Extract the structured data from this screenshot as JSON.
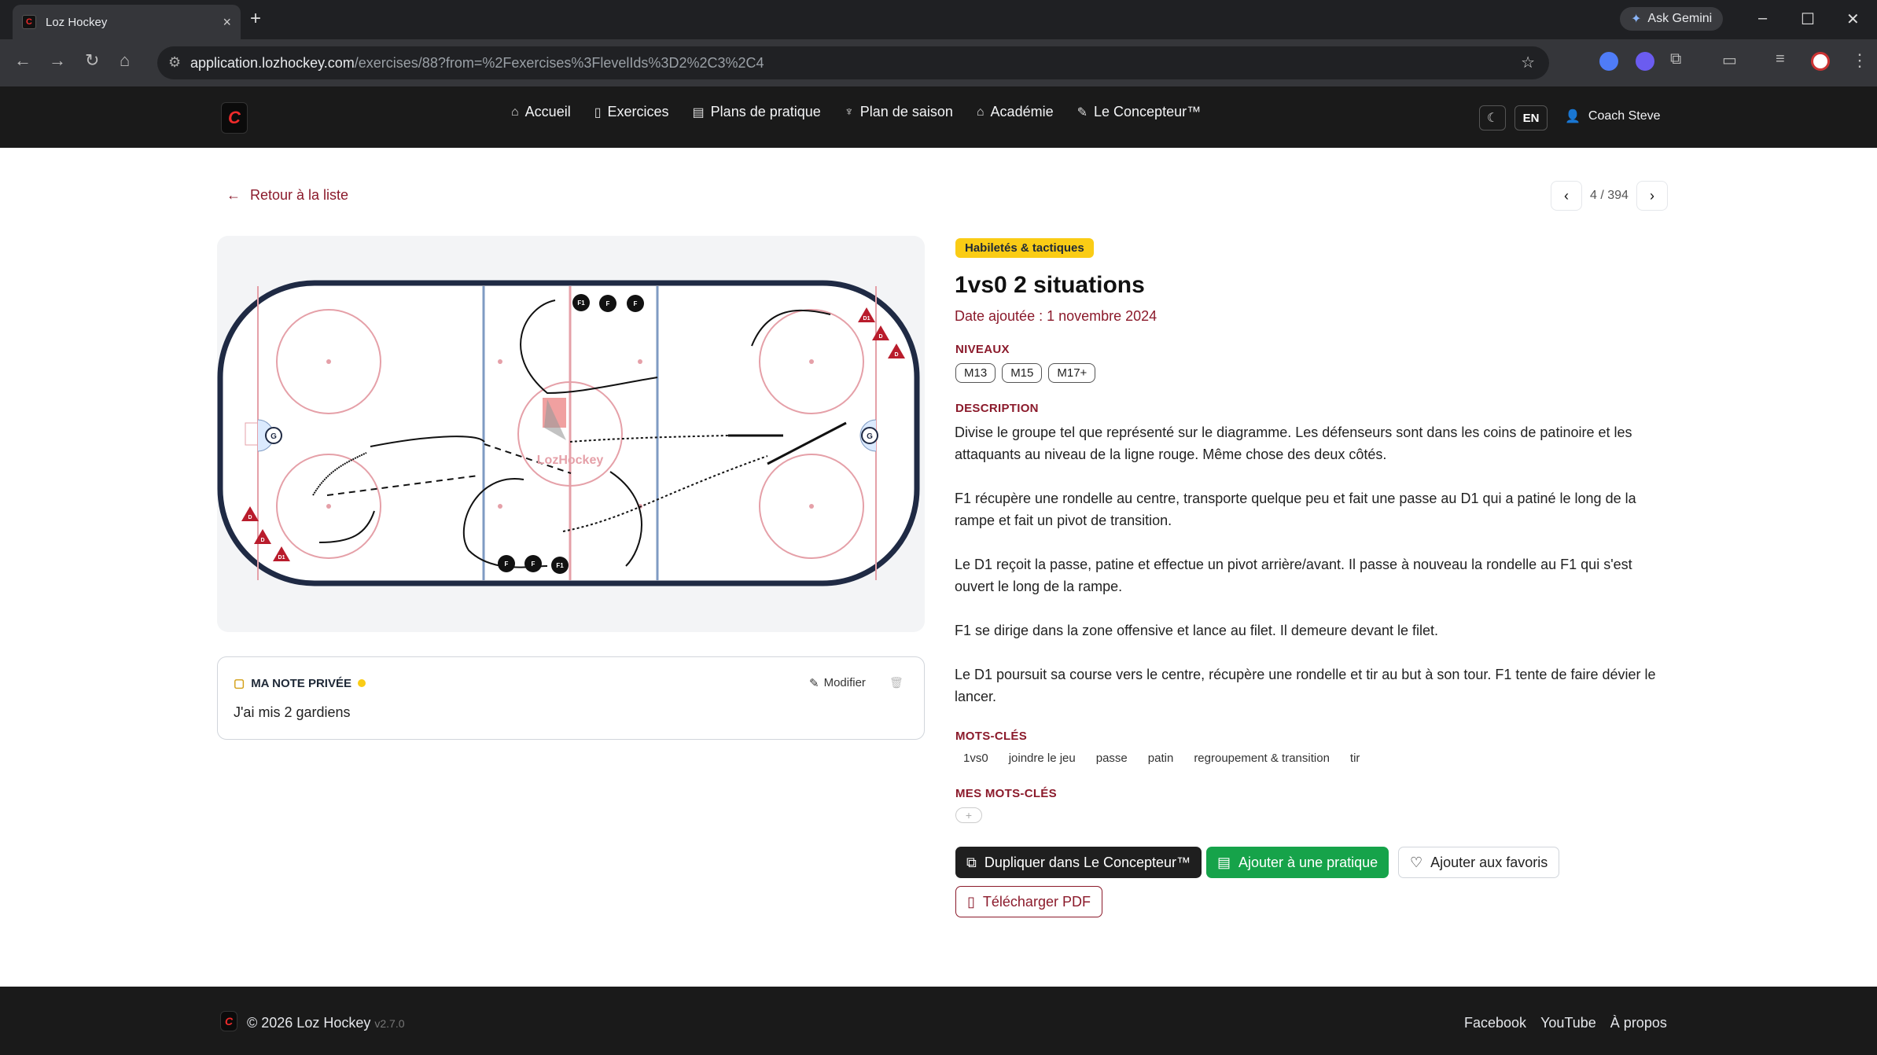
{
  "browser": {
    "tab_title": "Loz Hockey",
    "tab_close": "×",
    "new_tab": "+",
    "gemini_label": "Ask Gemini",
    "url_host": "application.lozhockey.com",
    "url_path": "/exercises/88?from=%2Fexercises%3FlevelIds%3D2%2C3%2C4"
  },
  "header": {
    "logo": "C",
    "nav": [
      {
        "label": "Accueil",
        "icon": "home-icon"
      },
      {
        "label": "Exercices",
        "icon": "book-icon"
      },
      {
        "label": "Plans de pratique",
        "icon": "clipboard-icon"
      },
      {
        "label": "Plan de saison",
        "icon": "trophy-icon"
      },
      {
        "label": "Académie",
        "icon": "graduation-cap-icon"
      },
      {
        "label": "Le Concepteur™",
        "icon": "pencil-icon"
      }
    ],
    "lang": "EN",
    "user": "Coach Steve"
  },
  "back_link": "Retour à la liste",
  "pager": {
    "text": "4 / 394"
  },
  "diagram": {
    "watermark": "LozHockey",
    "players_top": [
      "F1",
      "F",
      "F"
    ],
    "players_bottom": [
      "F",
      "F",
      "F1"
    ],
    "cones_left": [
      "D",
      "D",
      "D1"
    ],
    "cones_right": [
      "D1",
      "D",
      "D"
    ],
    "goalie": "G"
  },
  "note": {
    "heading": "MA NOTE PRIVÉE",
    "edit_label": "Modifier",
    "text": "J'ai mis 2 gardiens"
  },
  "exercise": {
    "category": "Habiletés & tactiques",
    "title": "1vs0 2 situations",
    "date": "Date ajoutée : 1 novembre 2024",
    "levels_label": "NIVEAUX",
    "levels": [
      "M13",
      "M15",
      "M17+"
    ],
    "description_label": "DESCRIPTION",
    "description": [
      "Divise le groupe tel que représenté sur le diagramme.  Les défenseurs sont dans les coins de patinoire et les attaquants au niveau de la ligne rouge.  Même chose des deux côtés.",
      "F1 récupère une rondelle au centre, transporte quelque peu et fait une passe au D1 qui a patiné le long de la rampe et fait un pivot de transition.",
      "Le D1 reçoit la passe, patine et effectue un pivot arrière/avant.  Il passe à nouveau la rondelle au F1 qui s'est ouvert le long de la rampe.",
      "F1 se dirige dans la zone offensive et lance au filet.  Il demeure devant le filet.",
      "Le D1 poursuit sa course vers le centre, récupère une rondelle et tir au but à son tour.  F1 tente de faire dévier le lancer."
    ],
    "keywords_label": "MOTS-CLÉS",
    "keywords": [
      "1vs0",
      "joindre le jeu",
      "passe",
      "patin",
      "regroupement & transition",
      "tir"
    ],
    "my_keywords_label": "MES MOTS-CLÉS",
    "add_symbol": "+",
    "buttons": {
      "duplicate": "Dupliquer dans Le Concepteur™",
      "add_practice": "Ajouter à une pratique",
      "favorite": "Ajouter aux favoris",
      "pdf": "Télécharger PDF"
    }
  },
  "footer": {
    "copyright": "© 2026 Loz Hockey",
    "version": "v2.7.0",
    "links": [
      "Facebook",
      "YouTube",
      "À propos"
    ]
  },
  "colors": {
    "accent": "#8b1a2b",
    "category": "#facc15",
    "success": "#16a34a",
    "dark": "#1a1a1a"
  }
}
